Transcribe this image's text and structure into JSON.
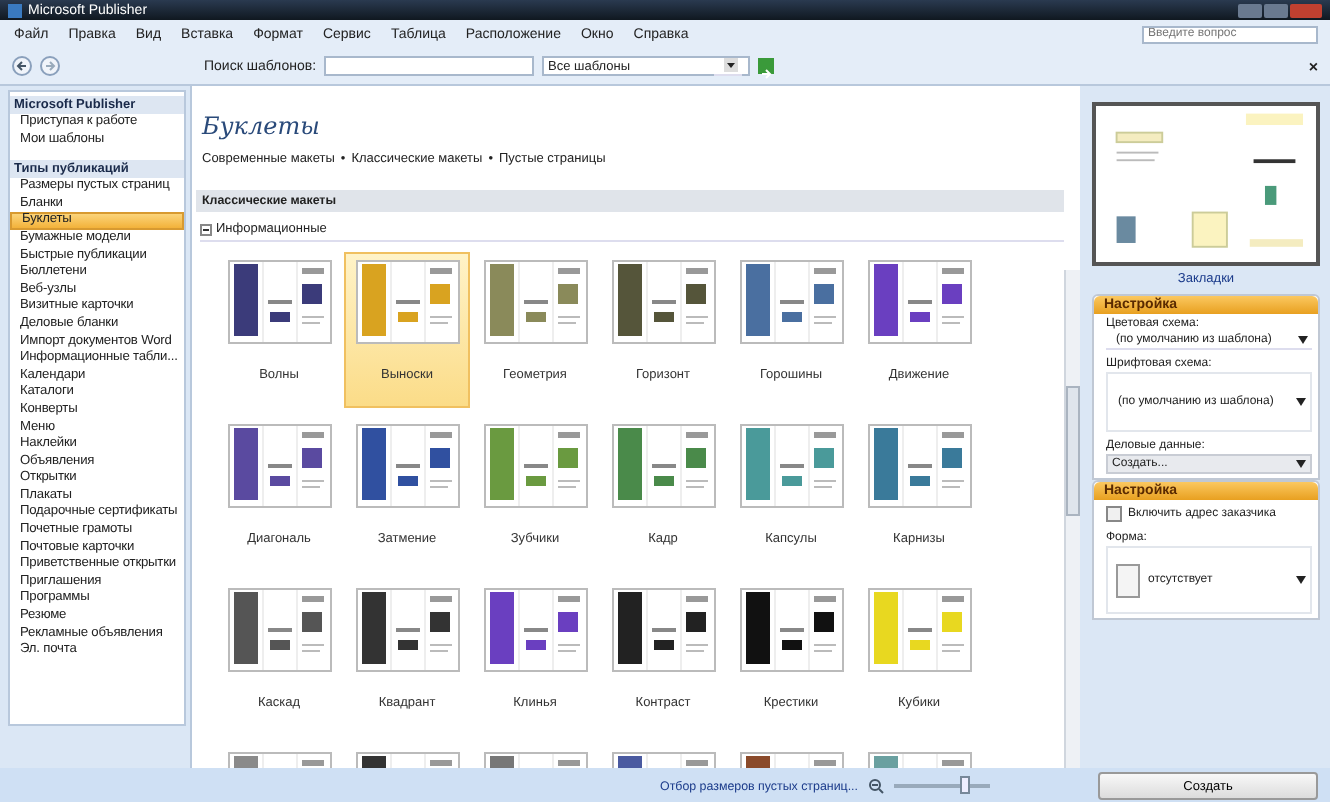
{
  "window": {
    "title": "Microsoft Publisher"
  },
  "menu": [
    "Файл",
    "Правка",
    "Вид",
    "Вставка",
    "Формат",
    "Сервис",
    "Таблица",
    "Расположение",
    "Окно",
    "Справка"
  ],
  "help_search": {
    "placeholder": "Введите вопрос"
  },
  "toolbar": {
    "search_label": "Поиск шаблонов:",
    "scope": "Все шаблоны",
    "close_label": "×"
  },
  "sidebar": {
    "sections": [
      {
        "title": "Microsoft Publisher",
        "items": [
          {
            "label": "Приступая к работе",
            "selected": false
          },
          {
            "label": "Мои шаблоны",
            "selected": false
          }
        ]
      },
      {
        "title": "Типы публикаций",
        "items": [
          {
            "label": "Размеры пустых страниц",
            "selected": false
          },
          {
            "label": "Бланки",
            "selected": false
          },
          {
            "label": "Буклеты",
            "selected": true
          },
          {
            "label": "Бумажные модели",
            "selected": false
          },
          {
            "label": "Быстрые публикации",
            "selected": false
          },
          {
            "label": "Бюллетени",
            "selected": false
          },
          {
            "label": "Веб-узлы",
            "selected": false
          },
          {
            "label": "Визитные карточки",
            "selected": false
          },
          {
            "label": "Деловые бланки",
            "selected": false
          },
          {
            "label": "Импорт документов Word",
            "selected": false
          },
          {
            "label": "Информационные табли...",
            "selected": false
          },
          {
            "label": "Календари",
            "selected": false
          },
          {
            "label": "Каталоги",
            "selected": false
          },
          {
            "label": "Конверты",
            "selected": false
          },
          {
            "label": "Меню",
            "selected": false
          },
          {
            "label": "Наклейки",
            "selected": false
          },
          {
            "label": "Объявления",
            "selected": false
          },
          {
            "label": "Открытки",
            "selected": false
          },
          {
            "label": "Плакаты",
            "selected": false
          },
          {
            "label": "Подарочные сертификаты",
            "selected": false
          },
          {
            "label": "Почетные грамоты",
            "selected": false
          },
          {
            "label": "Почтовые карточки",
            "selected": false
          },
          {
            "label": "Приветственные открытки",
            "selected": false
          },
          {
            "label": "Приглашения",
            "selected": false
          },
          {
            "label": "Программы",
            "selected": false
          },
          {
            "label": "Резюме",
            "selected": false
          },
          {
            "label": "Рекламные объявления",
            "selected": false
          },
          {
            "label": "Эл. почта",
            "selected": false
          }
        ]
      }
    ]
  },
  "gallery": {
    "title": "Буклеты",
    "breadcrumbs": [
      "Современные макеты",
      "Классические макеты",
      "Пустые страницы"
    ],
    "breadcrumb_separator": "•",
    "section": "Классические макеты",
    "group": {
      "label": "Информационные",
      "expanded": true
    },
    "templates": [
      {
        "name": "Волны",
        "selected": false,
        "color": "#3b3b7a"
      },
      {
        "name": "Выноски",
        "selected": true,
        "color": "#d9a320"
      },
      {
        "name": "Геометрия",
        "selected": false,
        "color": "#8a8a5a"
      },
      {
        "name": "Горизонт",
        "selected": false,
        "color": "#55553a"
      },
      {
        "name": "Горошины",
        "selected": false,
        "color": "#4a6fa0"
      },
      {
        "name": "Движение",
        "selected": false,
        "color": "#6a3fc0"
      },
      {
        "name": "Диагональ",
        "selected": false,
        "color": "#5a4aa0"
      },
      {
        "name": "Затмение",
        "selected": false,
        "color": "#3050a0"
      },
      {
        "name": "Зубчики",
        "selected": false,
        "color": "#6a9a40"
      },
      {
        "name": "Кадр",
        "selected": false,
        "color": "#4a8a4a"
      },
      {
        "name": "Капсулы",
        "selected": false,
        "color": "#4a9a9a"
      },
      {
        "name": "Карнизы",
        "selected": false,
        "color": "#3a7a9a"
      },
      {
        "name": "Каскад",
        "selected": false,
        "color": "#555555"
      },
      {
        "name": "Квадрант",
        "selected": false,
        "color": "#333333"
      },
      {
        "name": "Клинья",
        "selected": false,
        "color": "#6a3fc0"
      },
      {
        "name": "Контраст",
        "selected": false,
        "color": "#222222"
      },
      {
        "name": "Крестики",
        "selected": false,
        "color": "#111111"
      },
      {
        "name": "Кубики",
        "selected": false,
        "color": "#e8d820"
      }
    ],
    "more_thumbnails": [
      {
        "color": "#8a8a8a"
      },
      {
        "color": "#333333"
      },
      {
        "color": "#777777"
      },
      {
        "color": "#4a5aa0"
      },
      {
        "color": "#8a4a2a"
      },
      {
        "color": "#6aa0a0"
      }
    ]
  },
  "preview": {
    "caption": "Закладки"
  },
  "customize": [
    {
      "title": "Настройка",
      "fields": [
        {
          "kind": "dropdown",
          "label": "Цветовая схема:",
          "value": "(по умолчанию из шаблона)"
        },
        {
          "kind": "tall_dropdown",
          "label": "Шрифтовая схема:",
          "value": "(по умолчанию из шаблона)"
        },
        {
          "kind": "grey_dropdown",
          "label": "Деловые данные:",
          "value": "Создать..."
        }
      ]
    },
    {
      "title": "Настройка",
      "fields": [
        {
          "kind": "checkbox",
          "label": "Включить адрес заказчика",
          "checked": false
        },
        {
          "kind": "shape_dropdown",
          "label": "Форма:",
          "value": "отсутствует"
        }
      ]
    }
  ],
  "status_bar": {
    "text": "Отбор размеров пустых страниц...",
    "zoom": {
      "level": 0.72
    }
  },
  "create_button": "Создать"
}
